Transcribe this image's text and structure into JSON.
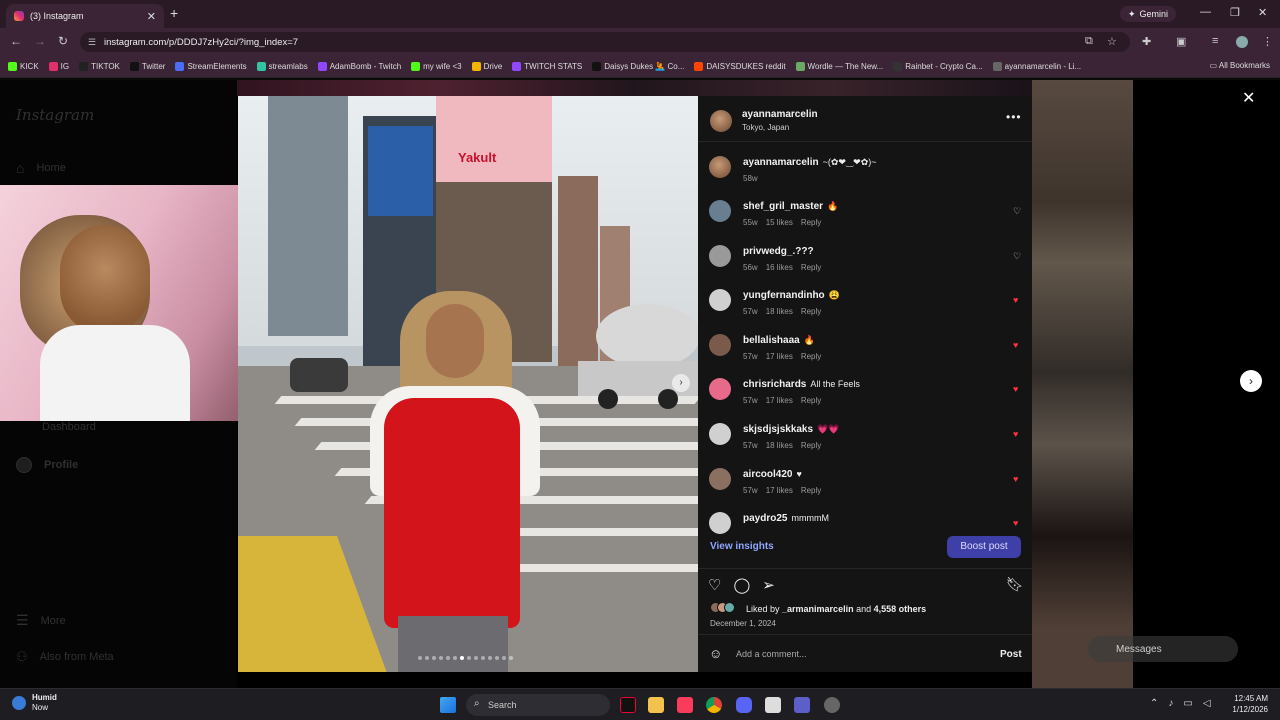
{
  "browser": {
    "tab_title": "(3) Instagram",
    "tab_close": "✕",
    "new_tab": "+",
    "gemini_label": "Gemini",
    "url": "instagram.com/p/DDDJ7zHy2ci/?img_index=7",
    "bookmarks": [
      "KICK",
      "IG",
      "TIKTOK",
      "Twitter",
      "StreamElements",
      "streamlabs",
      "AdamBomb - Twitch",
      "my wife <3",
      "Drive",
      "TWITCH STATS",
      "Daisys Dukes 🤽 Co...",
      "DAISYSDUKES reddit",
      "Wordle — The New...",
      "Rainbet - Crypto Ca...",
      "ayannamarcelin - Li..."
    ],
    "bookmark_colors": [
      "#53fc18",
      "#e1306c",
      "#222222",
      "#111111",
      "#4a6cf7",
      "#31c3a2",
      "#9146ff",
      "#53fc18",
      "#f4b400",
      "#9146ff",
      "#111111",
      "#ff4500",
      "#6aaa64",
      "#333333",
      "#666666"
    ],
    "all_bookmarks": "All Bookmarks"
  },
  "sidebar": {
    "logo": "Instagram",
    "home": "Home",
    "dashboard": "Dashboard",
    "profile": "Profile",
    "more": "More",
    "also_from_meta": "Also from Meta"
  },
  "post": {
    "author": "ayannamarcelin",
    "location": "Tokyo, Japan",
    "more_icon": "•••",
    "caption_user": "ayannamarcelin",
    "caption_text": "~(✿❤‿❤✿)~",
    "caption_age": "58w",
    "photo_sign": "Yakult",
    "carousel_dots": 14,
    "carousel_active": 7,
    "comments": [
      {
        "user": "shef_gril_master",
        "text": "🔥",
        "age": "55w",
        "likes": "15 likes",
        "reply": "Reply",
        "liked": false,
        "color": "#6a7e92"
      },
      {
        "user": "privwedg_.???",
        "text": "",
        "age": "56w",
        "likes": "16 likes",
        "reply": "Reply",
        "liked": false,
        "color": "#9a9a9a"
      },
      {
        "user": "yungfernandinho",
        "text": "😩",
        "age": "57w",
        "likes": "18 likes",
        "reply": "Reply",
        "liked": true,
        "color": "#d0d0d0"
      },
      {
        "user": "bellalishaaa",
        "text": "🔥",
        "age": "57w",
        "likes": "17 likes",
        "reply": "Reply",
        "liked": true,
        "color": "#7a5a4a"
      },
      {
        "user": "chrisrichards",
        "text": "All the Feels",
        "age": "57w",
        "likes": "17 likes",
        "reply": "Reply",
        "liked": true,
        "color": "#e86a8a"
      },
      {
        "user": "skjsdjsjskkaks",
        "text": "💗💗",
        "age": "57w",
        "likes": "18 likes",
        "reply": "Reply",
        "liked": true,
        "color": "#d0d0d0"
      },
      {
        "user": "aircool420",
        "text": "♥",
        "age": "57w",
        "likes": "17 likes",
        "reply": "Reply",
        "liked": true,
        "color": "#8a7060"
      },
      {
        "user": "paydro25",
        "text": "mmmmM",
        "age": "",
        "likes": "",
        "reply": "",
        "liked": true,
        "color": "#d0d0d0"
      }
    ],
    "view_insights": "View insights",
    "boost_post": "Boost post",
    "liked_by_prefix": "Liked by ",
    "liked_by_user": "_armanimarcelin",
    "liked_by_and": " and ",
    "liked_by_others": "4,558 others",
    "date": "December 1, 2024",
    "add_comment_placeholder": "Add a comment...",
    "post_button": "Post"
  },
  "overlay": {
    "close": "✕",
    "next": "›",
    "messages": "Messages"
  },
  "taskbar": {
    "weather_title": "Humid",
    "weather_sub": "Now",
    "weather_badge": "6",
    "search_placeholder": "Search",
    "time": "12:45 AM",
    "date": "1/12/2026"
  }
}
